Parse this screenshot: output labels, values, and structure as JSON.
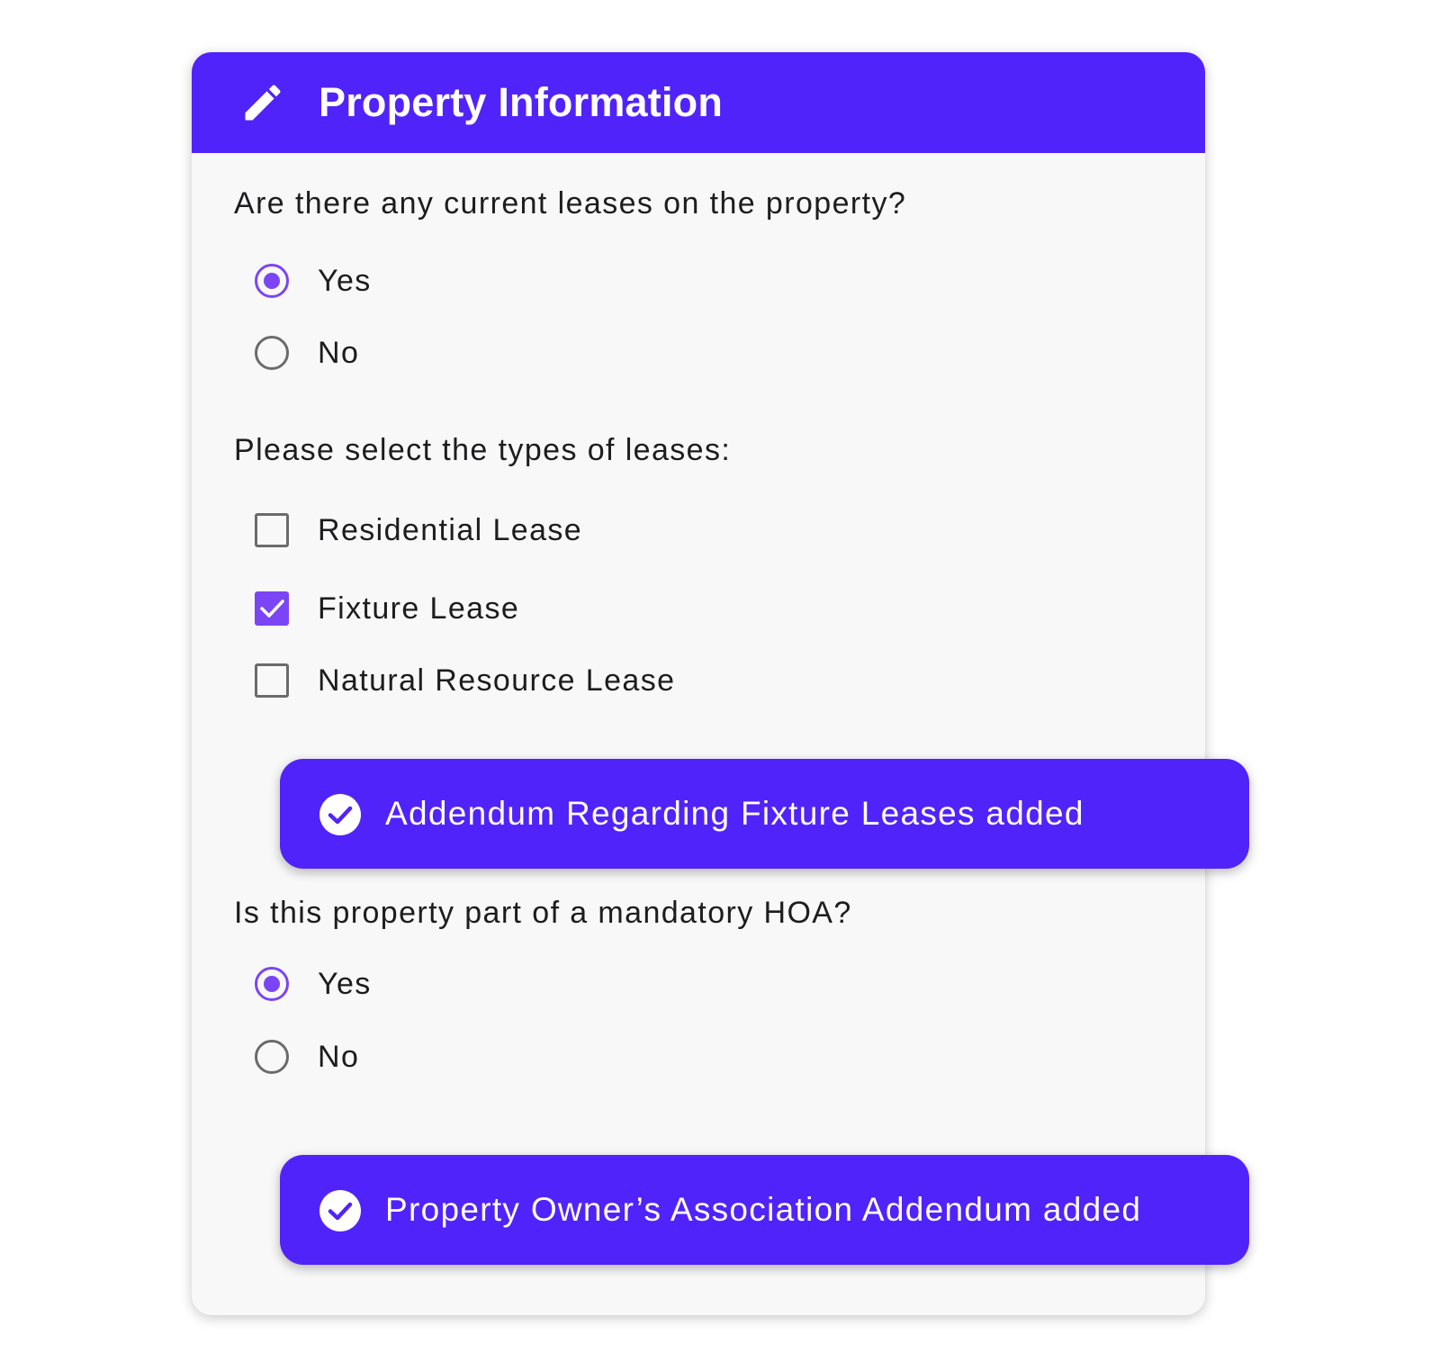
{
  "card": {
    "title": "Property Information",
    "title_icon": "pencil-icon"
  },
  "leases_question": {
    "text": "Are there any current leases on the property?",
    "options": [
      {
        "label": "Yes",
        "selected": true
      },
      {
        "label": "No",
        "selected": false
      }
    ]
  },
  "lease_types": {
    "text": "Please select the types of leases:",
    "options": [
      {
        "label": "Residential Lease",
        "checked": false
      },
      {
        "label": "Fixture Lease",
        "checked": true
      },
      {
        "label": "Natural Resource Lease",
        "checked": false
      }
    ]
  },
  "toasts": [
    {
      "text": "Addendum Regarding Fixture Leases added",
      "icon": "check-circle-icon"
    },
    {
      "text": "Property Owner’s Association Addendum added",
      "icon": "check-circle-icon"
    }
  ],
  "hoa_question": {
    "text": "Is this property part of a mandatory HOA?",
    "options": [
      {
        "label": "Yes",
        "selected": true
      },
      {
        "label": "No",
        "selected": false
      }
    ]
  },
  "colors": {
    "brand": "#5123fb",
    "accent": "#7b45f5",
    "card_background": "#f8f8f8",
    "unselected_control": "#6b6b6b"
  }
}
